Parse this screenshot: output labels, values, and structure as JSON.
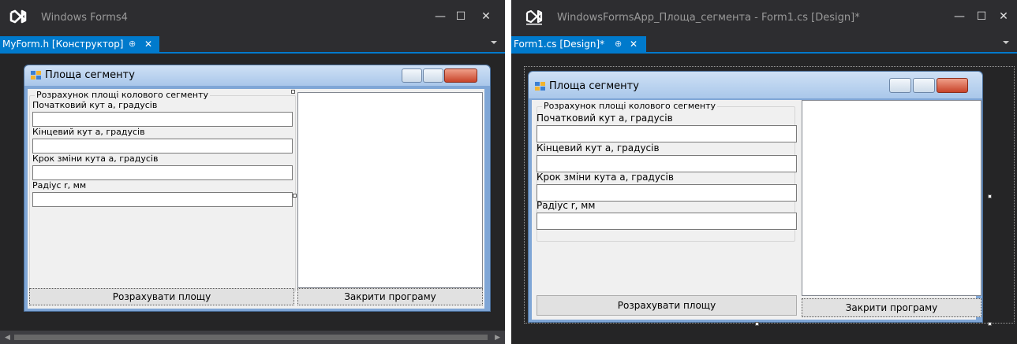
{
  "left": {
    "app_title": "Windows Forms4",
    "tab_label": "MyForm.h [Конструктор]",
    "tab_pin": "⊕",
    "tab_close": "✕",
    "form_title": "Площа сегменту",
    "group_label": "Розрахунок площі колового сегменту",
    "labels": [
      "Початковий кут а,  градусів",
      "Кінцевий кут а, градусів",
      "Крок зміни кута а,  градусів",
      "Радіус r, мм"
    ],
    "calc_button": "Розрахувати площу",
    "close_button": "Закрити програму"
  },
  "right": {
    "app_title": "WindowsFormsApp_Площа_сегмента - Form1.cs [Design]*",
    "tab_label": "Form1.cs [Design]*",
    "tab_pin": "⊕",
    "tab_close": "✕",
    "form_title": "Площа сегменту",
    "group_label": "Розрахунок площі колового сегменту",
    "labels": [
      "Початковий кут а, градусів",
      "Кінцевий кут а, градусів",
      "Крок зміни кута а, градусів",
      "Радіус r, мм"
    ],
    "calc_button": "Розрахувати площу",
    "close_button": "Закрити програму"
  },
  "window_controls": {
    "minimize": "—",
    "maximize": "☐",
    "close": "✕"
  },
  "icons": [
    "vs-logo-icon",
    "form-icon",
    "minimize-icon",
    "maximize-icon",
    "close-icon",
    "pin-icon",
    "dropdown-icon"
  ],
  "colors": {
    "accent": "#007acc",
    "ide_bg": "#2d2d30",
    "form_bg": "#f0f0f0"
  }
}
